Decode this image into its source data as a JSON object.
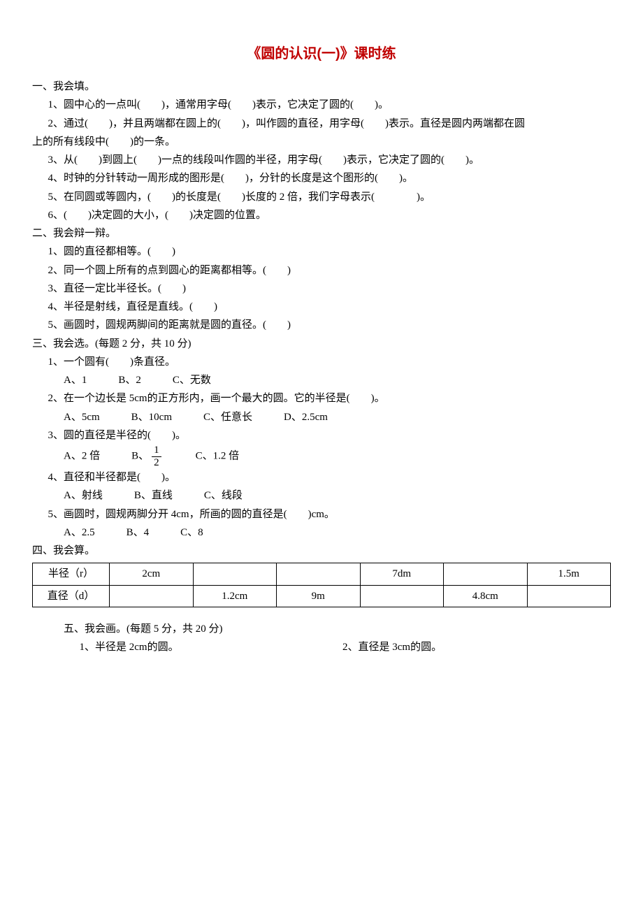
{
  "title": "《圆的认识(一)》课时练",
  "s1": {
    "heading": "一、我会填。",
    "q1": "1、圆中心的一点叫(　　)，通常用字母(　　)表示，它决定了圆的(　　)。",
    "q2": "2、通过(　　)，并且两端都在圆上的(　　)，叫作圆的直径，用字母(　　)表示。直径是圆内两端都在圆",
    "q2b": "上的所有线段中(　　)的一条。",
    "q3": "3、从(　　)到圆上(　　)一点的线段叫作圆的半径，用字母(　　)表示，它决定了圆的(　　)。",
    "q4": "4、时钟的分针转动一周形成的图形是(　　)，分针的长度是这个图形的(　　)。",
    "q5": "5、在同圆或等圆内，(　　)的长度是(　　)长度的 2 倍，我们字母表示(　　　　)。",
    "q6": "6、(　　)决定圆的大小，(　　)决定圆的位置。"
  },
  "s2": {
    "heading": "二、我会辩一辩。",
    "q1": "1、圆的直径都相等。(　　)",
    "q2": "2、同一个圆上所有的点到圆心的距离都相等。(　　)",
    "q3": "3、直径一定比半径长。(　　)",
    "q4": "4、半径是射线，直径是直线。(　　)",
    "q5": "5、画圆时，圆规两脚间的距离就是圆的直径。(　　)"
  },
  "s3": {
    "heading": "三、我会选。(每题 2 分，共 10 分)",
    "q1": "1、一个圆有(　　)条直径。",
    "q1o": "A、1　　　B、2　　　C、无数",
    "q2": "2、在一个边长是 5cm的正方形内，画一个最大的圆。它的半径是(　　)。",
    "q2o": "A、5cm　　　B、10cm　　　C、任意长　　　D、2.5cm",
    "q3": "3、圆的直径是半径的(　　)。",
    "q3oA": "A、2 倍　　　B、",
    "q3oB": "　　　C、1.2 倍",
    "frac": {
      "num": "1",
      "den": "2"
    },
    "q4": "4、直径和半径都是(　　)。",
    "q4o": "A、射线　　　B、直线　　　C、线段",
    "q5": "5、画圆时，圆规两脚分开 4cm，所画的圆的直径是(　　)cm。",
    "q5o": "A、2.5　　　B、4　　　C、8"
  },
  "s4": {
    "heading": "四、我会算。",
    "row1": "半径（r）",
    "row2": "直径（d）",
    "r": [
      "2cm",
      "",
      "",
      "7dm",
      "",
      "1.5m"
    ],
    "d": [
      "",
      "1.2cm",
      "9m",
      "",
      "4.8cm",
      ""
    ]
  },
  "s5": {
    "heading": "五、我会画。(每题 5 分，共 20 分)",
    "q1": "1、半径是 2cm的圆。",
    "q2": "2、直径是 3cm的圆。"
  }
}
